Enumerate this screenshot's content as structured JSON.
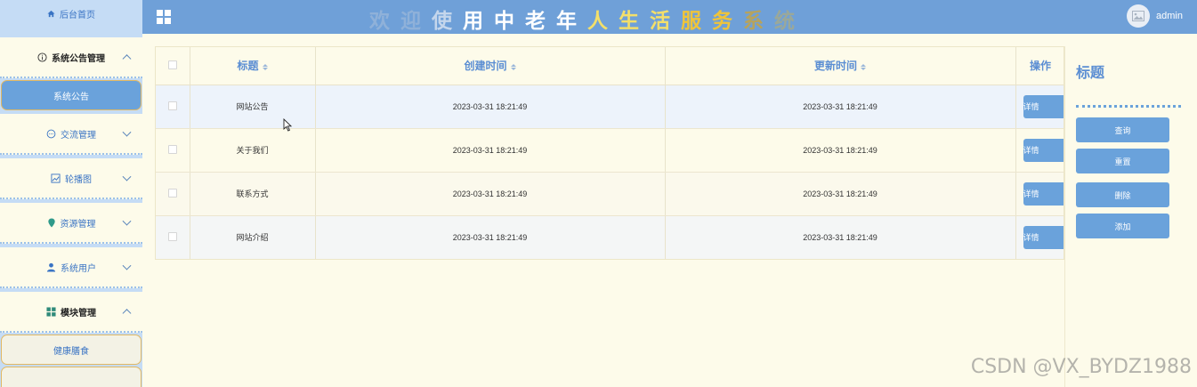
{
  "sidebar": {
    "home": "后台首页",
    "groups": [
      {
        "label": "系统公告管理",
        "expanded": true,
        "icon": "info-circle-icon"
      },
      {
        "label": "交流管理",
        "expanded": false,
        "icon": "chat-icon"
      },
      {
        "label": "轮播图",
        "expanded": false,
        "icon": "image-icon"
      },
      {
        "label": "资源管理",
        "expanded": false,
        "icon": "location-pin-icon"
      },
      {
        "label": "系统用户",
        "expanded": false,
        "icon": "user-icon"
      },
      {
        "label": "模块管理",
        "expanded": true,
        "icon": "grid-icon"
      }
    ],
    "sub_notice": "系统公告",
    "sub_module": "健康膳食"
  },
  "header": {
    "title_chars": [
      "欢",
      "迎",
      "使",
      "用",
      "中",
      "老",
      "年",
      "人",
      "生",
      "活",
      "服",
      "务",
      "系",
      "统"
    ],
    "title_colors": [
      "#8fb1d9",
      "#8fb1d9",
      "#c4d6ec",
      "#ffffff",
      "#ffffff",
      "#ffffff",
      "#ffffff",
      "#f3df6a",
      "#f3df6a",
      "#f3df6a",
      "#efc43a",
      "#efc43a",
      "#b7a35c",
      "#9aa89a"
    ],
    "user": "admin",
    "accent": "#6fa0d8"
  },
  "table": {
    "headers": {
      "title": "标题",
      "created": "创建时间",
      "updated": "更新时间",
      "action": "操作"
    },
    "action_label": "详情",
    "rows": [
      {
        "title": "网站公告",
        "created": "2023-03-31 18:21:49",
        "updated": "2023-03-31 18:21:49"
      },
      {
        "title": "关于我们",
        "created": "2023-03-31 18:21:49",
        "updated": "2023-03-31 18:21:49"
      },
      {
        "title": "联系方式",
        "created": "2023-03-31 18:21:49",
        "updated": "2023-03-31 18:21:49"
      },
      {
        "title": "网站介绍",
        "created": "2023-03-31 18:21:49",
        "updated": "2023-03-31 18:21:49"
      }
    ]
  },
  "panel": {
    "title": "标题",
    "query": "查询",
    "reset": "重置",
    "delete": "删除",
    "add": "添加"
  },
  "watermark": "CSDN @VX_BYDZ1988"
}
